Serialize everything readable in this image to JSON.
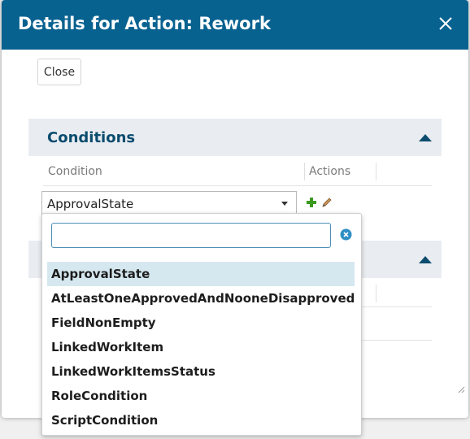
{
  "dialog": {
    "title": "Details for Action: Rework",
    "close_label": "Close"
  },
  "conditions": {
    "title": "Conditions",
    "columns": [
      "Condition",
      "Actions"
    ],
    "selected_value": "ApprovalState"
  },
  "dropdown": {
    "search_value": "",
    "options": [
      "ApprovalState",
      "AtLeastOneApprovedAndNooneDisapproved",
      "FieldNonEmpty",
      "LinkedWorkItem",
      "LinkedWorkItemsStatus",
      "RoleCondition",
      "ScriptCondition"
    ],
    "selected_index": 0
  },
  "colors": {
    "titlebar": "#086290",
    "section_header_bg": "#e9edf1",
    "section_title": "#0b4c6f",
    "selected_option_bg": "#d6e8ef",
    "add_icon": "#3a9a1f",
    "clear_icon": "#2f8fc4"
  },
  "icons": {
    "close": "close-icon",
    "collapse": "chevron-up-icon",
    "add": "plus-icon",
    "edit": "pencil-icon",
    "clear": "clear-circle-icon"
  }
}
